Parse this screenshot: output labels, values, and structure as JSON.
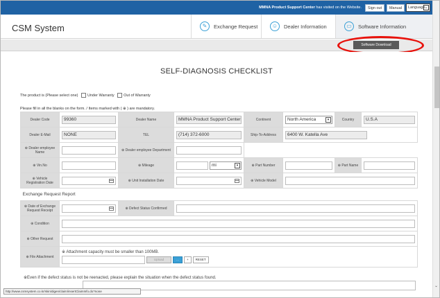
{
  "topbar": {
    "visit_strong": "MMNA Product Support Center",
    "visit_text": " has visited on the Website.",
    "sign_out": "Sign out",
    "manual": "Manual",
    "language": "Language"
  },
  "header": {
    "logo": "CSM System",
    "tabs": [
      {
        "label": "Exchange Request"
      },
      {
        "label": "Dealer Information"
      },
      {
        "label": "Software Information"
      }
    ]
  },
  "subbar": {
    "software_download": "Software Download"
  },
  "page": {
    "title": "SELF-DIAGNOSIS CHECKLIST",
    "product_prompt": "The product is (Please select one)",
    "under_warranty": "Under Warranty",
    "out_of_warranty": "Out of Warranty",
    "mandatory_note": "Please fill in all the blanks on the form. / Items marked with ( ⊕ ) are mandatory.",
    "section_exchange": "Exchange Request Report",
    "bottom_note": "※Even if the defect status is not be reenacted, please explain the situation when the defect status found."
  },
  "form": {
    "dealer_code_label": "Dealer Code",
    "dealer_code": "99360",
    "dealer_name_label": "Dealer Name",
    "dealer_name": "MMNA Product Support Center",
    "continent_label": "Continent",
    "continent": "North America",
    "country_label": "Country",
    "country": "U.S.A",
    "dealer_email_label": "Dealer E-Mail",
    "dealer_email": "NONE",
    "tel_label": "TEL",
    "tel": "(714) 372-6000",
    "ship_to_label": "Ship-To-Address",
    "ship_to": "6400 W. Katella Ave",
    "employee_name_label": "⊕ Dealer employee Name",
    "employee_dept_label": "⊕ Dealer employee Department",
    "vin_label": "⊕ Vin.No",
    "mileage_label": "⊕ Mileage",
    "mileage_unit": "mi",
    "part_number_label": "⊕ Part Number",
    "part_name_label": "⊕ Part Name",
    "reg_date_label": "⊕ Vehicle Registration Date",
    "install_date_label": "⊕ Unit Installation Date",
    "vehicle_model_label": "⊕ Vehicle Model",
    "exchange_date_label": "⊕ Date of Exchange Request Receipt",
    "defect_confirmed_label": "⊕ Defect Status Confirmed",
    "condition_label": "⊕ Condition",
    "other_request_label": "⊕ Other Request",
    "file_attachment_label": "⊕ File Attachment",
    "attachment_note": "※ Attachment capacity must be smaller than 100MB.",
    "upload": "Upload",
    "plus": "+",
    "reset": "RESET"
  },
  "statusbar": {
    "url": "http://www.csmsystem.co.kr/skin/digen/claim/insertClaimInfo.do?none"
  }
}
